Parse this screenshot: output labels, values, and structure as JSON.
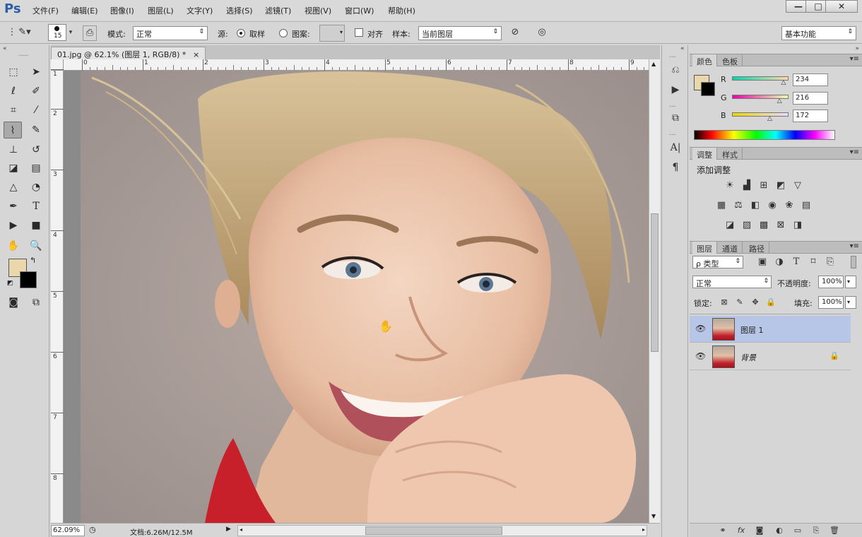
{
  "app": {
    "logo": "Ps",
    "menu": [
      "文件(F)",
      "编辑(E)",
      "图像(I)",
      "图层(L)",
      "文字(Y)",
      "选择(S)",
      "滤镜(T)",
      "视图(V)",
      "窗口(W)",
      "帮助(H)"
    ],
    "window_controls": [
      "—",
      "□",
      "✕"
    ]
  },
  "options": {
    "brush_size": "15",
    "mode_label": "模式:",
    "mode_value": "正常",
    "source_label": "源:",
    "sampled_label": "取样",
    "pattern_label": "图案:",
    "aligned_label": "对齐",
    "sample_label": "样本:",
    "sample_value": "当前图层",
    "workspace": "基本功能"
  },
  "document": {
    "tab_title": "01.jpg @ 62.1% (图层 1, RGB/8) *",
    "tab_close": "×",
    "ruler_top_numbers": [
      "0",
      "1",
      "2",
      "3",
      "4",
      "5",
      "6",
      "7",
      "8",
      "9"
    ],
    "ruler_left_numbers": [
      "1",
      "2",
      "3",
      "4",
      "5",
      "6",
      "7",
      "8"
    ],
    "zoom": "62.09%",
    "doc_info": "文档:6.26M/12.5M"
  },
  "color_panel": {
    "tabs": [
      "颜色",
      "色板"
    ],
    "labels": [
      "R",
      "G",
      "B"
    ],
    "values": [
      "234",
      "216",
      "172"
    ],
    "fill_fractions": [
      0.918,
      0.847,
      0.675
    ],
    "foreground": "#ead8ac",
    "background": "#000000"
  },
  "adjust_panel": {
    "tabs": [
      "调整",
      "样式"
    ],
    "title": "添加调整",
    "row1_icons": [
      "brightness-icon",
      "levels-icon",
      "curves-icon",
      "exposure-icon",
      "vibrance-icon"
    ],
    "row2_icons": [
      "hue-saturation-icon",
      "color-balance-icon",
      "black-white-icon",
      "photo-filter-icon",
      "channel-mixer-icon",
      "color-lookup-icon"
    ],
    "row3_icons": [
      "invert-icon",
      "posterize-icon",
      "threshold-icon",
      "selective-color-icon",
      "gradient-map-icon"
    ]
  },
  "layers_panel": {
    "tabs": [
      "图层",
      "通道",
      "路径"
    ],
    "filter_kind": "ρ 类型",
    "blend_mode": "正常",
    "opacity_label": "不透明度:",
    "opacity_value": "100%",
    "lock_label": "锁定:",
    "fill_label": "填充:",
    "fill_value": "100%",
    "layers": [
      {
        "name": "图层 1",
        "selected": true,
        "locked": false
      },
      {
        "name": "背景",
        "selected": false,
        "locked": true
      }
    ]
  },
  "colors": {
    "ps_blue": "#2d5ea5",
    "selected_layer": "#b7c6e6"
  }
}
